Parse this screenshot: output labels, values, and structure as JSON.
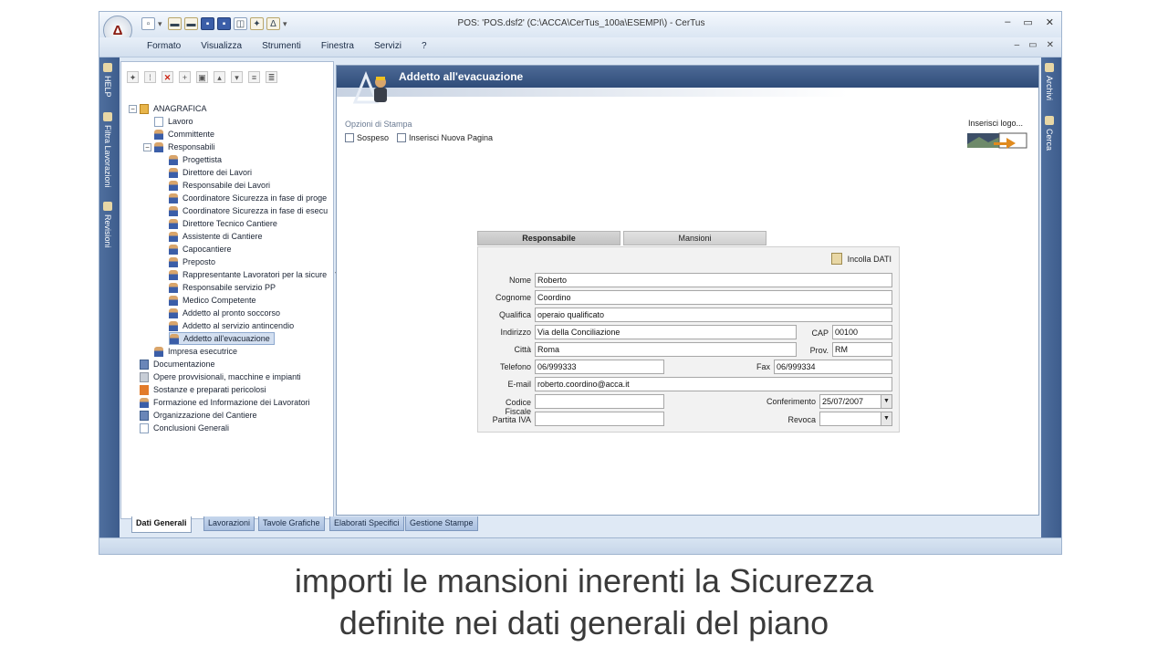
{
  "window": {
    "title": "POS: 'POS.dsf2'   (C:\\ACCA\\CerTus_100a\\ESEMPI\\) - CerTus",
    "min": "–",
    "max": "▭",
    "close": "✕"
  },
  "menu": [
    "Formato",
    "Visualizza",
    "Strumenti",
    "Finestra",
    "Servizi",
    "?"
  ],
  "mdi": {
    "min": "–",
    "restore": "▭",
    "close": "✕"
  },
  "left_strip": [
    "HELP",
    "Filtra Lavorazioni",
    "Revisioni"
  ],
  "right_strip": [
    "Archivi",
    "Cerca"
  ],
  "tree": {
    "root": "ANAGRAFICA",
    "lavoro": "Lavoro",
    "committente": "Committente",
    "responsabili": "Responsabili",
    "responsabili_children": [
      "Progettista",
      "Direttore dei Lavori",
      "Responsabile dei Lavori",
      "Coordinatore Sicurezza in fase di proge",
      "Coordinatore Sicurezza in fase di esecu",
      "Direttore Tecnico Cantiere",
      "Assistente di Cantiere",
      "Capocantiere",
      "Preposto",
      "Rappresentante Lavoratori per la sicure",
      "Responsabile servizio PP",
      "Medico Competente",
      "Addetto al pronto soccorso",
      "Addetto al servizio antincendio",
      "Addetto all'evacuazione"
    ],
    "impresa": "Impresa esecutrice",
    "others": [
      "Documentazione",
      "Opere provvisionali, macchine e impianti",
      "Sostanze e preparati pericolosi",
      "Formazione ed Informazione dei Lavoratori",
      "Organizzazione del Cantiere",
      "Conclusioni Generali"
    ]
  },
  "bottom_tabs": [
    "Dati Generali",
    "Lavorazioni",
    "Tavole Grafiche",
    "Elaborati Specifici",
    "Gestione Stampe"
  ],
  "doc": {
    "title": "Addetto all'evacuazione",
    "options_label": "Opzioni di Stampa",
    "sospeso": "Sospeso",
    "nuova_pagina": "Inserisci Nuova Pagina",
    "insert_logo": "Inserisci logo...",
    "tabs": [
      "Responsabile",
      "Mansioni"
    ],
    "paste": "Incolla DATI"
  },
  "form": {
    "nome_label": "Nome",
    "nome": "Roberto",
    "cognome_label": "Cognome",
    "cognome": "Coordino",
    "qualifica_label": "Qualifica",
    "qualifica": "operaio qualificato",
    "indirizzo_label": "Indirizzo",
    "indirizzo": "Via della Conciliazione",
    "cap_label": "CAP",
    "cap": "00100",
    "citta_label": "Città",
    "citta": "Roma",
    "prov_label": "Prov.",
    "prov": "RM",
    "telefono_label": "Telefono",
    "telefono": "06/999333",
    "fax_label": "Fax",
    "fax": "06/999334",
    "email_label": "E-mail",
    "email": "roberto.coordino@acca.it",
    "cf_label": "Codice Fiscale",
    "cf": "",
    "conferimento_label": "Conferimento",
    "conferimento": "25/07/2007",
    "piva_label": "Partita IVA",
    "piva": "",
    "revoca_label": "Revoca",
    "revoca": ""
  },
  "caption": {
    "line1": "importi le mansioni inerenti la Sicurezza",
    "line2": "definite nei dati generali del piano"
  }
}
